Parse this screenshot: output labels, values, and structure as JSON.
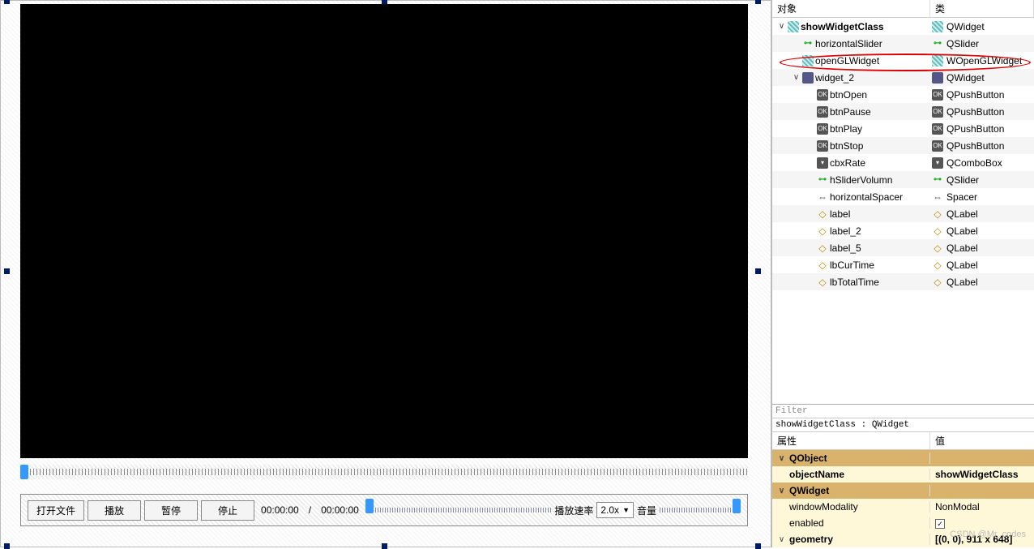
{
  "designer": {
    "buttons": {
      "open": "打开文件",
      "play": "播放",
      "pause": "暂停",
      "stop": "停止"
    },
    "time": {
      "cur": "00:00:00",
      "sep": "/",
      "total": "00:00:00"
    },
    "rate_label": "播放速率",
    "rate_value": "2.0x",
    "volume_label": "音量"
  },
  "inspector": {
    "headers": {
      "object": "对象",
      "class": "类"
    },
    "tree": [
      {
        "depth": 0,
        "expand": "∨",
        "name": "showWidgetClass",
        "class": "QWidget",
        "icon": "widget",
        "bold": true
      },
      {
        "depth": 1,
        "expand": "",
        "name": "horizontalSlider",
        "class": "QSlider",
        "icon": "slider"
      },
      {
        "depth": 1,
        "expand": "",
        "name": "openGLWidget",
        "class": "WOpenGLWidget",
        "icon": "widget",
        "highlight": true
      },
      {
        "depth": 1,
        "expand": "∨",
        "name": "widget_2",
        "class": "QWidget",
        "icon": "layout"
      },
      {
        "depth": 2,
        "expand": "",
        "name": "btnOpen",
        "class": "QPushButton",
        "icon": "btn"
      },
      {
        "depth": 2,
        "expand": "",
        "name": "btnPause",
        "class": "QPushButton",
        "icon": "btn"
      },
      {
        "depth": 2,
        "expand": "",
        "name": "btnPlay",
        "class": "QPushButton",
        "icon": "btn"
      },
      {
        "depth": 2,
        "expand": "",
        "name": "btnStop",
        "class": "QPushButton",
        "icon": "btn"
      },
      {
        "depth": 2,
        "expand": "",
        "name": "cbxRate",
        "class": "QComboBox",
        "icon": "combo"
      },
      {
        "depth": 2,
        "expand": "",
        "name": "hSliderVolumn",
        "class": "QSlider",
        "icon": "slider"
      },
      {
        "depth": 2,
        "expand": "",
        "name": "horizontalSpacer",
        "class": "Spacer",
        "icon": "spacer"
      },
      {
        "depth": 2,
        "expand": "",
        "name": "label",
        "class": "QLabel",
        "icon": "label"
      },
      {
        "depth": 2,
        "expand": "",
        "name": "label_2",
        "class": "QLabel",
        "icon": "label"
      },
      {
        "depth": 2,
        "expand": "",
        "name": "label_5",
        "class": "QLabel",
        "icon": "label"
      },
      {
        "depth": 2,
        "expand": "",
        "name": "lbCurTime",
        "class": "QLabel",
        "icon": "label"
      },
      {
        "depth": 2,
        "expand": "",
        "name": "lbTotalTime",
        "class": "QLabel",
        "icon": "label"
      }
    ]
  },
  "properties": {
    "filter_placeholder": "Filter",
    "class_line": "showWidgetClass : QWidget",
    "headers": {
      "name": "属性",
      "value": "值"
    },
    "rows": [
      {
        "type": "cat",
        "expand": "∨",
        "name": "QObject",
        "value": ""
      },
      {
        "type": "yellow",
        "name": "objectName",
        "value": "showWidgetClass",
        "bold": true
      },
      {
        "type": "cat",
        "expand": "∨",
        "name": "QWidget",
        "value": ""
      },
      {
        "type": "yellow",
        "name": "windowModality",
        "value": "NonModal"
      },
      {
        "type": "yellow",
        "name": "enabled",
        "value": "",
        "checkbox": true
      },
      {
        "type": "yellow",
        "expand": "∨",
        "name": "geometry",
        "value": "[(0, 0), 911 x 648]",
        "bold": true
      }
    ]
  },
  "watermark": "CSDN @Mr_codes"
}
